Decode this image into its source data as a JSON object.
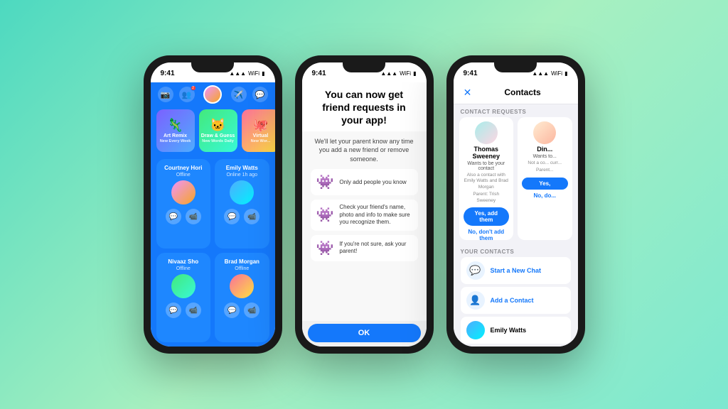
{
  "background": "linear-gradient(135deg, #4dd9c0 0%, #a8f0c0 50%, #7de8d0 100%)",
  "phone1": {
    "time": "9:41",
    "contacts": [
      {
        "name": "Courtney Hori",
        "status": "Offline",
        "avatarClass": "ca1"
      },
      {
        "name": "Emily Watts",
        "status": "Online 1h ago",
        "avatarClass": "ca2"
      },
      {
        "name": "Nivaaz Sho",
        "status": "Offline",
        "avatarClass": "ca3"
      },
      {
        "name": "Brad Morgan",
        "status": "Offline",
        "avatarClass": "ca4"
      }
    ],
    "games": [
      {
        "title": "Art Remix",
        "sub": "New Every Week",
        "emoji": "🦎",
        "class": "gc1"
      },
      {
        "title": "Draw & Guess",
        "sub": "New Words Daily",
        "emoji": "🐱",
        "class": "gc2"
      },
      {
        "title": "Virtual",
        "sub": "New Wor...",
        "emoji": "🐙",
        "class": "gc3"
      }
    ]
  },
  "phone2": {
    "time": "9:41",
    "title": "You can now get friend requests in your app!",
    "subtitle": "We'll let your parent know any time you add a new friend or remove someone.",
    "tips": [
      {
        "emoji": "👾",
        "text": "Only add people you know"
      },
      {
        "emoji": "👾",
        "text": "Check your friend's name, photo and info to make sure you recognize them."
      },
      {
        "emoji": "👾",
        "text": "If you're not sure, ask your parent!"
      }
    ],
    "ok_label": "OK"
  },
  "phone3": {
    "time": "9:41",
    "title": "Contacts",
    "close_icon": "✕",
    "section_requests": "CONTACT REQUESTS",
    "section_contacts": "YOUR CONTACTS",
    "requests": [
      {
        "name": "Thomas Sweeney",
        "wants": "Wants to be your contact",
        "info": "Also a contact with Emily Watts and Brad Morgan",
        "parent": "Parent: Trish Sweeney",
        "yes_label": "Yes, add them",
        "no_label": "No, don't add them",
        "avatarClass": "ra1"
      },
      {
        "name": "Din...",
        "wants": "Wants to...",
        "info": "Not a co... curr...",
        "parent": "Parent...",
        "yes_label": "Yes,",
        "no_label": "No, do...",
        "avatarClass": "ra2"
      }
    ],
    "actions": [
      {
        "icon": "💬",
        "label": "Start a New Chat",
        "bg": "#e8f3ff"
      },
      {
        "icon": "👤",
        "label": "Add a Contact",
        "bg": "#e8f3ff"
      }
    ],
    "emily": "Emily Watts"
  }
}
